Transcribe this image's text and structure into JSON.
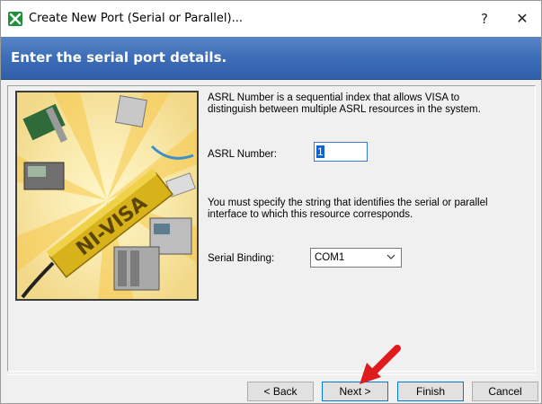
{
  "window": {
    "title": "Create New Port (Serial or Parallel)...",
    "help_label": "?",
    "close_label": "✕"
  },
  "header": {
    "title": "Enter the serial port details."
  },
  "content": {
    "description_1": "ASRL Number is a sequential index that allows VISA to distinguish between multiple ASRL resources in the system.",
    "asrl_label": "ASRL Number:",
    "asrl_value": "1",
    "description_2": "You must specify the string that identifies the serial or parallel interface to which this resource corresponds.",
    "binding_label": "Serial Binding:",
    "binding_value": "COM1"
  },
  "illustration": {
    "logo_text": "NI-VISA"
  },
  "buttons": {
    "back": "< Back",
    "next": "Next >",
    "finish": "Finish",
    "cancel": "Cancel"
  },
  "colors": {
    "header_blue": "#3e6fb8",
    "focus_blue": "#0078d7",
    "arrow_red": "#e01b1b",
    "logo_gold": "#d8b21a"
  }
}
